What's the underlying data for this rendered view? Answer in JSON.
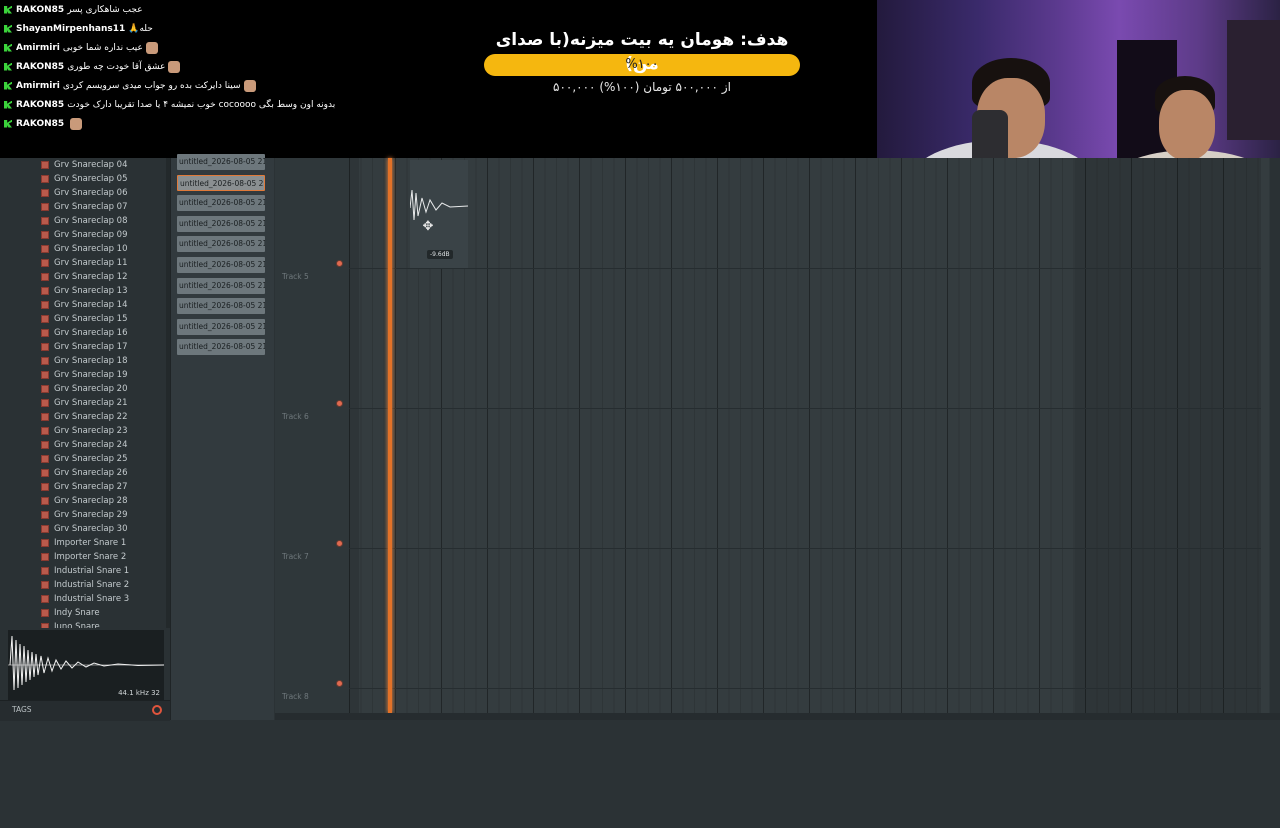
{
  "chat": [
    {
      "user": "RAKON85",
      "message": "عجب شاهکاری پسر",
      "emoji": false
    },
    {
      "user": "ShayanMirpenhans11",
      "message": "🙏حله",
      "emoji": false
    },
    {
      "user": "Amirmiri",
      "message": "عیب نداره شما خوبی",
      "emoji": true
    },
    {
      "user": "RAKON85",
      "message": "عشق آقا خودت چه طوری",
      "emoji": true
    },
    {
      "user": "Amirmiri",
      "message": "سینا دایرکت بده رو جواب میدی سرویسم کردی",
      "emoji": true
    },
    {
      "user": "RAKON85",
      "message": "خوب نمیشه ۴ یا صدا تقریبا دارک خودت cocoooo بدونه اون وسط بگی",
      "emoji": false
    },
    {
      "user": "RAKON85",
      "message": "",
      "emoji": true
    }
  ],
  "goal": {
    "title": "هدف: هومان یه بیت میزنه(با صدای من)",
    "progress": 1.0,
    "percent_label": "%۱۰۰",
    "amount": "۵۰۰,۰۰۰ از ۵۰۰,۰۰۰ تومان (۱۰۰%)"
  },
  "browser": {
    "items": [
      "Grv Snareclap 04",
      "Grv Snareclap 05",
      "Grv Snareclap 06",
      "Grv Snareclap 07",
      "Grv Snareclap 08",
      "Grv Snareclap 09",
      "Grv Snareclap 10",
      "Grv Snareclap 11",
      "Grv Snareclap 12",
      "Grv Snareclap 13",
      "Grv Snareclap 14",
      "Grv Snareclap 15",
      "Grv Snareclap 16",
      "Grv Snareclap 17",
      "Grv Snareclap 18",
      "Grv Snareclap 19",
      "Grv Snareclap 20",
      "Grv Snareclap 21",
      "Grv Snareclap 22",
      "Grv Snareclap 23",
      "Grv Snareclap 24",
      "Grv Snareclap 25",
      "Grv Snareclap 26",
      "Grv Snareclap 27",
      "Grv Snareclap 28",
      "Grv Snareclap 29",
      "Grv Snareclap 30",
      "Importer Snare 1",
      "Importer Snare 2",
      "Industrial Snare 1",
      "Industrial Snare 2",
      "Industrial Snare 3",
      "Indy Snare",
      "Juno Snare"
    ],
    "sample_info": "44.1 kHz 32",
    "tags_label": "TAGS"
  },
  "picker": {
    "clips": [
      "untitled_2026-08-05 21-...",
      "untitled_2026-08-05 21-...",
      "untitled_2026-08-05 21-...",
      "untitled_2026-08-05 21-...",
      "untitled_2026-08-05 21-...",
      "untitled_2026-08-05 21-...",
      "untitled_2026-08-05 21-...",
      "untitled_2026-08-05 21-...",
      "untitled_2026-08-05 21-...",
      "untitled_2026-08-05 21-..."
    ],
    "selected_index": 1
  },
  "playlist": {
    "tracks": [
      "Track 5",
      "Track 6",
      "Track 7",
      "Track 8"
    ],
    "clip_volume": "-9.6dB"
  },
  "colors": {
    "accent": "#e37228",
    "goal_bar": "#f5b70f",
    "chat_badge": "#3bd33b"
  }
}
